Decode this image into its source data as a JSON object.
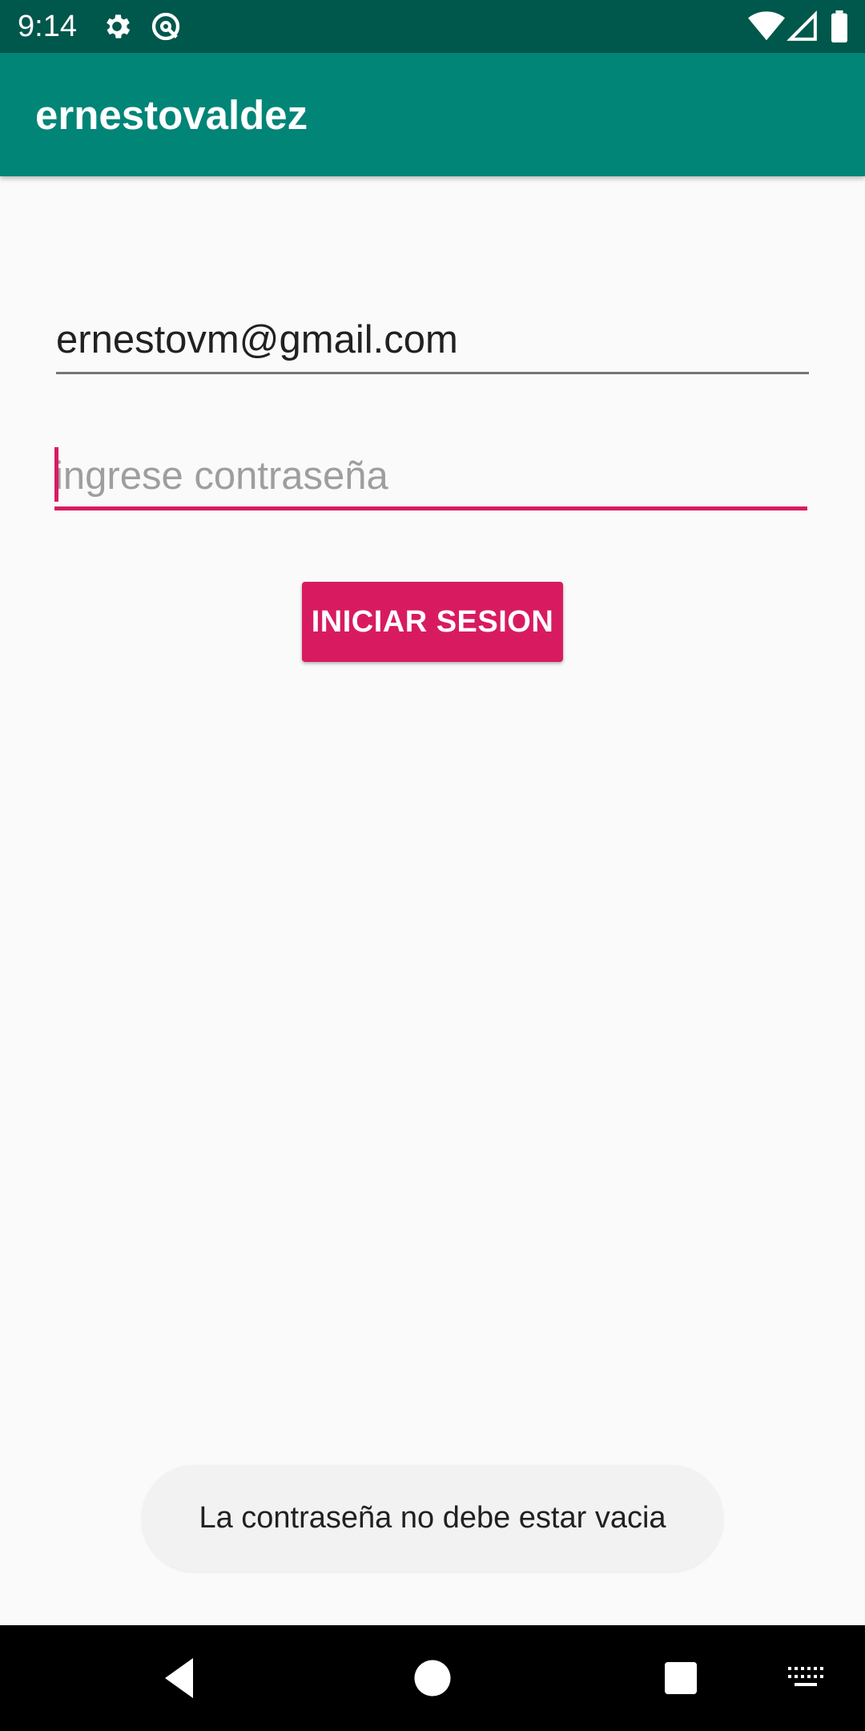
{
  "status_bar": {
    "time": "9:14",
    "icons": [
      "gear-icon",
      "sync-icon",
      "wifi-icon",
      "signal-icon",
      "battery-icon"
    ]
  },
  "app_bar": {
    "title": "ernestovaldez"
  },
  "login_form": {
    "email_value": "ernestovm@gmail.com",
    "password_placeholder": "ingrese contraseña",
    "password_value": "",
    "submit_label": "INICIAR SESION"
  },
  "toast": {
    "message": "La contraseña no debe estar vacia"
  },
  "nav_bar": {
    "buttons": [
      "back-icon",
      "home-icon",
      "recents-icon",
      "keyboard-icon"
    ]
  },
  "colors": {
    "status_bar": "#00574b",
    "app_bar": "#008577",
    "accent": "#d81b60",
    "background": "#fafafa"
  }
}
